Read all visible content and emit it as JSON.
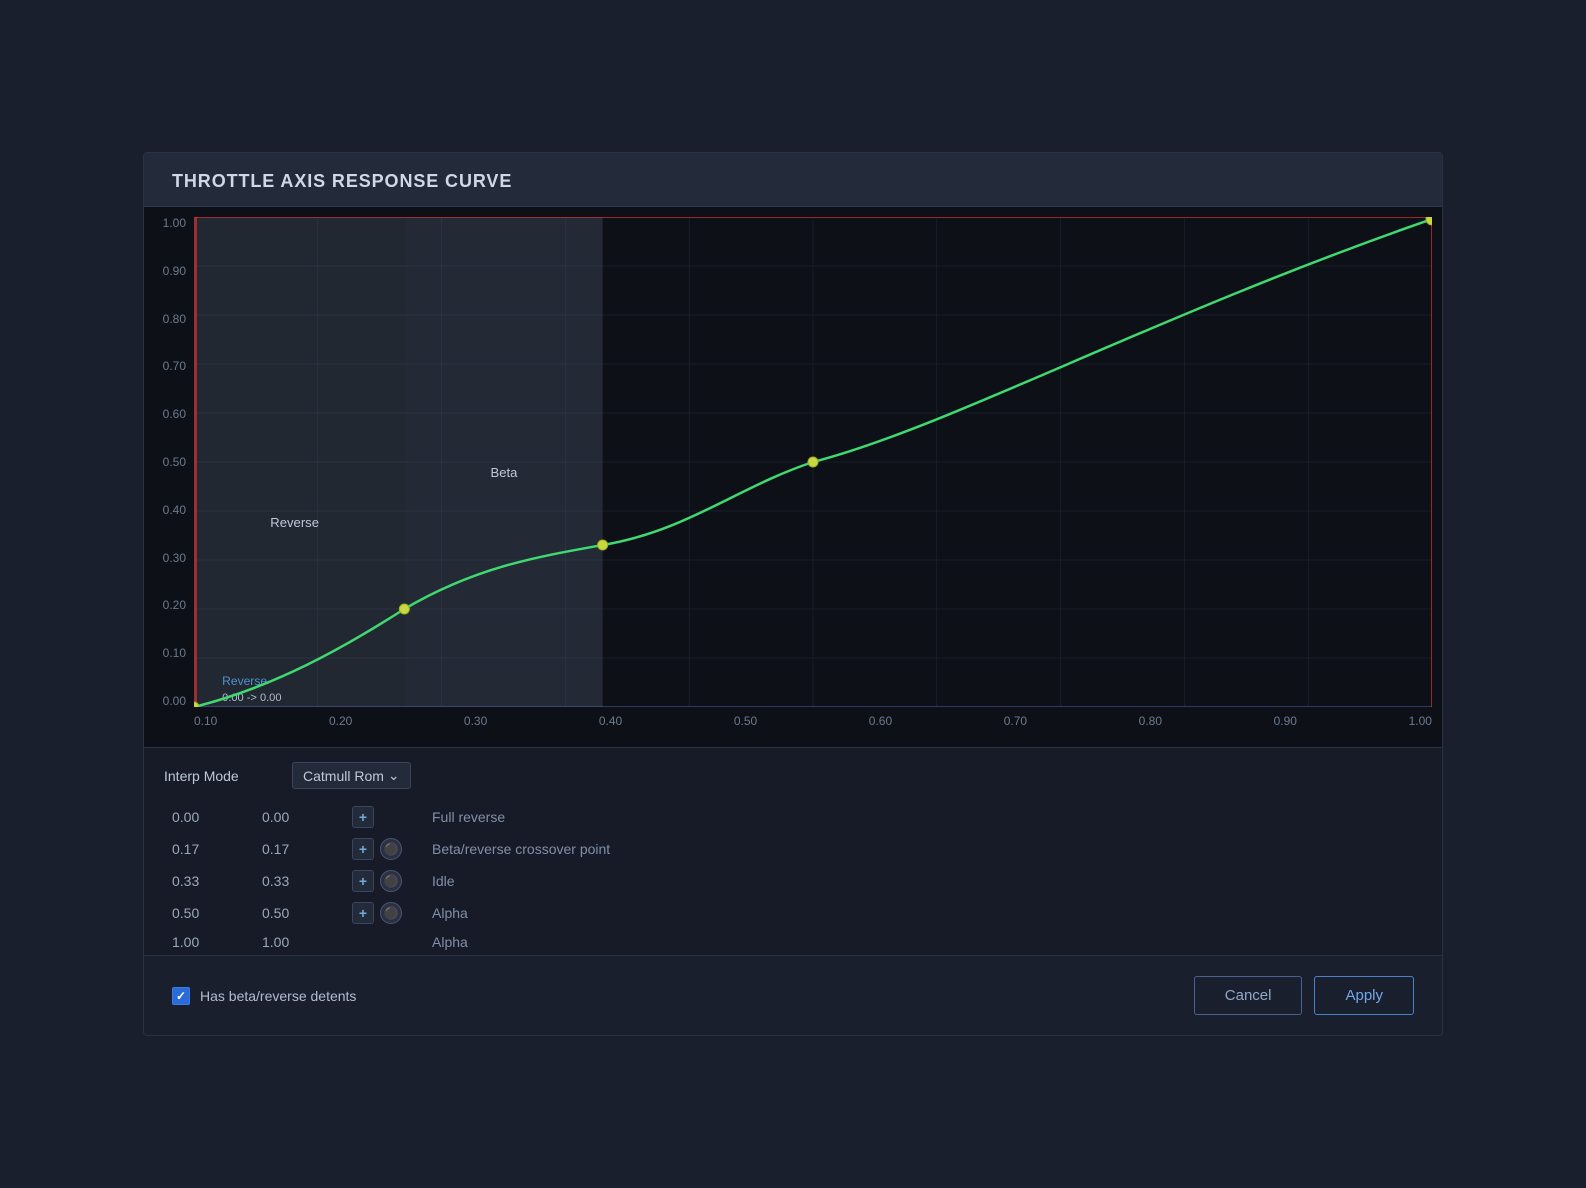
{
  "dialog": {
    "title": "THROTTLE AXIS RESPONSE CURVE"
  },
  "chart": {
    "y_labels": [
      "1.00",
      "0.90",
      "0.80",
      "0.70",
      "0.60",
      "0.50",
      "0.40",
      "0.30",
      "0.20",
      "0.10",
      "0.00"
    ],
    "x_labels": [
      "0.10",
      "0.20",
      "0.30",
      "0.40",
      "0.50",
      "0.60",
      "0.70",
      "0.80",
      "0.90",
      "1.00"
    ],
    "region_reverse_label": "Reverse",
    "region_beta_label": "Beta",
    "reverse_axis_label": "Reverse",
    "crosshair_label": "0.00 -> 0.00"
  },
  "table": {
    "interp_mode_label": "Interp Mode",
    "interp_mode_value": "Catmull Rom",
    "rows": [
      {
        "x": "0.00",
        "y": "0.00",
        "has_add": true,
        "has_del": false,
        "comment": "Full reverse"
      },
      {
        "x": "0.17",
        "y": "0.17",
        "has_add": true,
        "has_del": true,
        "comment": "Beta/reverse crossover point"
      },
      {
        "x": "0.33",
        "y": "0.33",
        "has_add": true,
        "has_del": true,
        "comment": "Idle"
      },
      {
        "x": "0.50",
        "y": "0.50",
        "has_add": true,
        "has_del": true,
        "comment": "Alpha"
      },
      {
        "x": "1.00",
        "y": "1.00",
        "has_add": false,
        "has_del": false,
        "comment": "Alpha"
      }
    ]
  },
  "footer": {
    "checkbox_label": "Has beta/reverse detents",
    "checkbox_checked": true,
    "cancel_label": "Cancel",
    "apply_label": "Apply"
  }
}
